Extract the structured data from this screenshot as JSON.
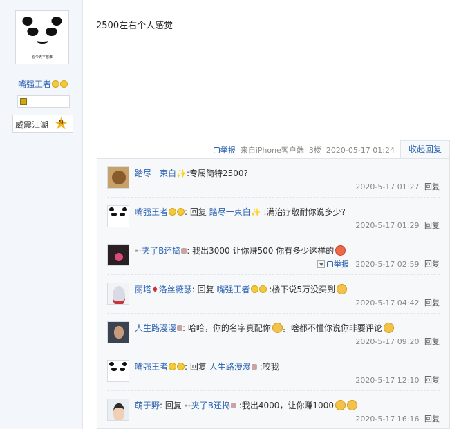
{
  "poster": {
    "avatar_caption": "看今天不憋谁",
    "name": "嘴强王者",
    "rank_label": "威震江湖",
    "level": "9"
  },
  "post": {
    "content": "2500左右个人感觉",
    "report_label": "举报",
    "source": "来自iPhone客户端",
    "floor": "3楼",
    "timestamp": "2020-05-17 01:24",
    "fold_label": "收起回复"
  },
  "replies": [
    {
      "author": "踏尽一束白",
      "text": ":专属简特2500?",
      "time": "2020-5-17 01:27",
      "reply_label": "回复",
      "avatar": "brown-avatar"
    },
    {
      "author": "嘴强王者",
      "reply_word": "回复",
      "target": "踏尽一束白",
      "text": ":满治疗敬耐你说多少?",
      "time": "2020-5-17 01:29",
      "reply_label": "回复",
      "avatar": "panda-avatar"
    },
    {
      "author": "夹了B还捣",
      "text": ": 我出3000 让你赚500 你有多少这样的",
      "time": "2020-5-17 02:59",
      "report_label": "举报",
      "reply_label": "回复",
      "avatar": "dark-avatar"
    },
    {
      "author": "丽塔",
      "author_suffix": "洛丝薇瑟",
      "reply_word": "回复",
      "target": "嘴强王者",
      "text": ":楼下说5万没买到",
      "time": "2020-5-17 04:42",
      "reply_label": "回复",
      "avatar": "anime-avatar"
    },
    {
      "author": "人生路漫漫",
      "text": ": 哈哈，你的名字真配你",
      "text2": "。啥都不懂你说你非要评论",
      "time": "2020-5-17 09:20",
      "reply_label": "回复",
      "avatar": "man-avatar"
    },
    {
      "author": "嘴强王者",
      "reply_word": "回复",
      "target": "人生路漫漫",
      "text": ":咬我",
      "time": "2020-5-17 12:10",
      "reply_label": "回复",
      "avatar": "panda-avatar"
    },
    {
      "author": "萌于野",
      "reply_word": "回复",
      "target": "夹了B还捣",
      "text": ":我出4000，让你赚1000",
      "time": "2020-5-17 16:16",
      "reply_label": "回复",
      "avatar": "kid-avatar"
    }
  ]
}
